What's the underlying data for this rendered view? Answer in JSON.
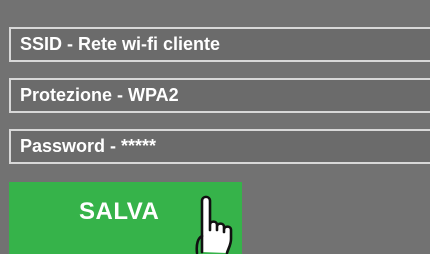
{
  "form": {
    "ssid_label": "SSID - Rete wi-fi cliente",
    "protection_label": "Protezione - WPA2",
    "password_label": "Password - *****"
  },
  "actions": {
    "save_label": "SALVA"
  },
  "colors": {
    "background": "#727272",
    "field_background": "#6b6b6b",
    "field_border": "#d8d8d8",
    "save_button": "#36b34a",
    "text": "#ffffff"
  },
  "icons": {
    "pointer": "hand-pointer-icon"
  }
}
